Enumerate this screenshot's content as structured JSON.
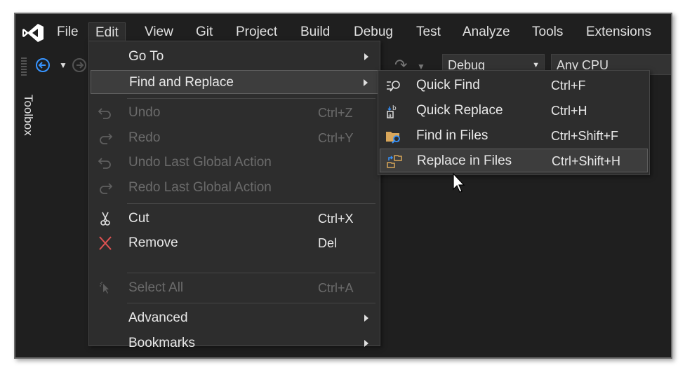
{
  "menubar": {
    "items": [
      {
        "label": "File"
      },
      {
        "label": "Edit"
      },
      {
        "label": "View"
      },
      {
        "label": "Git"
      },
      {
        "label": "Project"
      },
      {
        "label": "Build"
      },
      {
        "label": "Debug"
      },
      {
        "label": "Test"
      },
      {
        "label": "Analyze"
      },
      {
        "label": "Tools"
      },
      {
        "label": "Extensions"
      }
    ],
    "active": "Edit"
  },
  "toolbar": {
    "configuration": "Debug",
    "platform": "Any CPU"
  },
  "sidebar": {
    "toolbox_label": "Toolbox"
  },
  "edit_menu": {
    "items": [
      {
        "label": "Go To",
        "shortcut": "",
        "submenu": true,
        "enabled": true
      },
      {
        "label": "Find and Replace",
        "shortcut": "",
        "submenu": true,
        "enabled": true,
        "highlighted": true
      },
      {
        "label": "Undo",
        "shortcut": "Ctrl+Z",
        "enabled": false
      },
      {
        "label": "Redo",
        "shortcut": "Ctrl+Y",
        "enabled": false
      },
      {
        "label": "Undo Last Global Action",
        "shortcut": "",
        "enabled": false
      },
      {
        "label": "Redo Last Global Action",
        "shortcut": "",
        "enabled": false
      },
      {
        "label": "Cut",
        "shortcut": "Ctrl+X",
        "enabled": true
      },
      {
        "label": "Remove",
        "shortcut": "Del",
        "enabled": true
      },
      {
        "label": "Select All",
        "shortcut": "Ctrl+A",
        "enabled": false
      },
      {
        "label": "Advanced",
        "shortcut": "",
        "submenu": true,
        "enabled": true
      },
      {
        "label": "Bookmarks",
        "shortcut": "",
        "submenu": true,
        "enabled": true
      }
    ]
  },
  "find_replace_submenu": {
    "items": [
      {
        "label": "Quick Find",
        "shortcut": "Ctrl+F",
        "icon": "quick-find-icon"
      },
      {
        "label": "Quick Replace",
        "shortcut": "Ctrl+H",
        "icon": "quick-replace-icon"
      },
      {
        "label": "Find in Files",
        "shortcut": "Ctrl+Shift+F",
        "icon": "find-in-files-icon"
      },
      {
        "label": "Replace in Files",
        "shortcut": "Ctrl+Shift+H",
        "icon": "replace-in-files-icon",
        "highlighted": true
      }
    ]
  },
  "colors": {
    "background": "#1f1f1f",
    "menu_bg": "#2d2d2d",
    "highlight": "#3d3d3d",
    "text": "#e8e8e8",
    "disabled_text": "#6b6b6b",
    "accent_blue": "#3794ff",
    "remove_red": "#e05252"
  }
}
